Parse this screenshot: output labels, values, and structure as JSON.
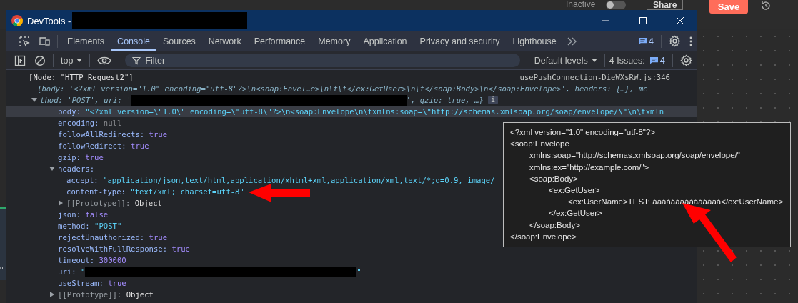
{
  "background_app": {
    "toggle_label": "Inactive",
    "toggle_on": false,
    "share_label": "Share",
    "save_label": "Save",
    "side_text": "ut"
  },
  "window": {
    "title": "DevTools -",
    "title_redacted": true
  },
  "tabs": [
    {
      "label": "Elements",
      "selected": false
    },
    {
      "label": "Console",
      "selected": true
    },
    {
      "label": "Sources",
      "selected": false
    },
    {
      "label": "Network",
      "selected": false
    },
    {
      "label": "Performance",
      "selected": false
    },
    {
      "label": "Memory",
      "selected": false
    },
    {
      "label": "Application",
      "selected": false
    },
    {
      "label": "Privacy and security",
      "selected": false
    },
    {
      "label": "Lighthouse",
      "selected": false
    }
  ],
  "tab_bar_issues": "4",
  "toolbar": {
    "context": "top",
    "filter_placeholder": "Filter",
    "levels": "Default levels",
    "issues_label": "4 Issues:",
    "issues_count": "4"
  },
  "console": [
    {
      "kind": "node",
      "text": "[Node: \"HTTP Request2\"]",
      "source": "usePushConnection-DieWXsRW.js:346"
    },
    {
      "kind": "summary",
      "expanded": true,
      "line_1": "{body: '<?xml version=\"1.0\" encoding=\"utf-8\"?>\\n<soap:Envel…e>\\n\\t\\t</ex:GetUser>\\n\\t</soap:Body>\\n</soap:Envelope>', headers: {…}, me",
      "line_2_before": "thod: 'POST', uri: '",
      "line_2_after": "', gzip: true, …}",
      "badge": "i",
      "children": [
        {
          "key": "body:",
          "value": "\"<?xml version=\\\"1.0\\\" encoding=\\\"utf-8\\\"?>\\n<soap:Envelope\\n\\txmlns:soap=\\\"http://schemas.xmlsoap.org/soap/envelope/\\\"\\n\\txmln",
          "kind": "string",
          "highlighted": true
        },
        {
          "key": "encoding:",
          "value": "null",
          "kind": "null",
          "highlighted": false
        },
        {
          "key": "followAllRedirects:",
          "value": "true",
          "kind": "boolean",
          "highlighted": false
        },
        {
          "key": "followRedirect:",
          "value": "true",
          "kind": "boolean",
          "highlighted": false
        },
        {
          "key": "gzip:",
          "value": "true",
          "kind": "boolean",
          "highlighted": false
        },
        {
          "key": "headers:",
          "kind": "object",
          "expanded": true,
          "highlighted": false,
          "children": [
            {
              "key": "accept:",
              "value": "\"application/json,text/html,application/xhtml+xml,application/xml,text/*;q=0.9, image/",
              "kind": "string",
              "highlighted": false
            },
            {
              "key": "content-type:",
              "value": "\"text/xml; charset=utf-8\"",
              "kind": "string",
              "highlighted": false
            },
            {
              "key": "[[Prototype]]:",
              "value": "Object",
              "kind": "prototype",
              "expanded": false,
              "highlighted": false
            }
          ]
        },
        {
          "key": "json:",
          "value": "false",
          "kind": "boolean",
          "highlighted": false
        },
        {
          "key": "method:",
          "value": "\"POST\"",
          "kind": "string",
          "highlighted": false
        },
        {
          "key": "rejectUnauthorized:",
          "value": "true",
          "kind": "boolean",
          "highlighted": false
        },
        {
          "key": "resolveWithFullResponse:",
          "value": "true",
          "kind": "boolean",
          "highlighted": false
        },
        {
          "key": "timeout:",
          "value": "300000",
          "kind": "number",
          "highlighted": false
        },
        {
          "key": "uri:",
          "value": "\"",
          "value_after": "\"",
          "kind": "redacted",
          "highlighted": false
        },
        {
          "key": "useStream:",
          "value": "true",
          "kind": "boolean",
          "highlighted": false
        },
        {
          "key": "[[Prototype]]:",
          "value": "Object",
          "kind": "prototype",
          "expanded": false,
          "highlighted": false
        }
      ]
    }
  ],
  "tooltip": [
    {
      "text": "<?xml version=\"1.0\" encoding=\"utf-8\"?>"
    },
    {
      "text": "<soap:Envelope",
      "children": [
        {
          "text": "xmlns:soap=\"http://schemas.xmlsoap.org/soap/envelope/\""
        },
        {
          "text": "xmlns:ex=\"http://example.com/\">"
        },
        {
          "text": "<soap:Body>",
          "children": [
            {
              "text": "<ex:GetUser>",
              "children": [
                {
                  "text": "<ex:UserName>TEST: ááááááááááááááá</ex:UserName>"
                }
              ]
            },
            {
              "text": "</ex:GetUser>"
            }
          ]
        },
        {
          "text": "</soap:Body>"
        }
      ]
    },
    {
      "text": "</soap:Envelope>"
    }
  ]
}
